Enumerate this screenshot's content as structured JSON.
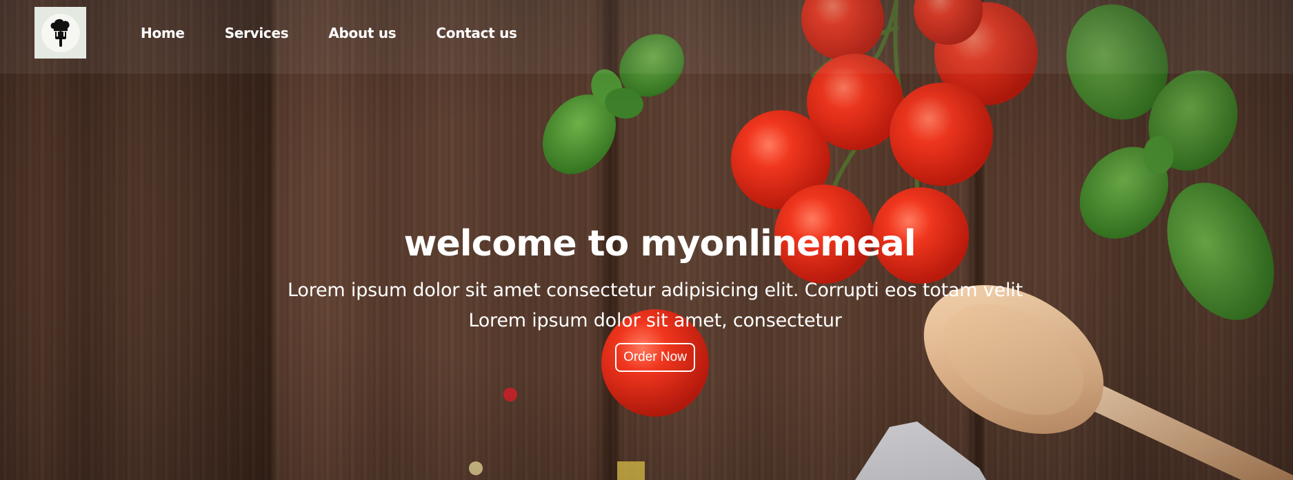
{
  "nav": {
    "logo_icon": "chef-fork-icon",
    "links": [
      {
        "label": "Home"
      },
      {
        "label": "Services"
      },
      {
        "label": "About us"
      },
      {
        "label": "Contact us"
      }
    ]
  },
  "hero": {
    "title": "welcome to myonlinemeal",
    "subtitle_line1": "Lorem ipsum dolor sit amet consectetur adipisicing elit. Corrupti eos totam velit",
    "subtitle_line2": "Lorem ipsum dolor sit amet, consectetur",
    "cta_label": "Order Now"
  },
  "colors": {
    "text": "#ffffff",
    "wood": "#563a2c",
    "tomato": "#e8301c",
    "basil": "#3f8a2c"
  }
}
